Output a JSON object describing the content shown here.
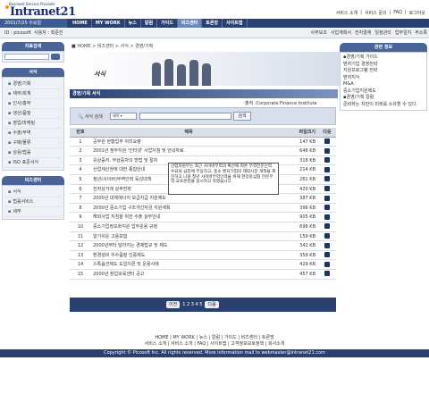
{
  "header": {
    "tagline": "Business Service Provider",
    "logo": "Intranet21",
    "top_links": [
      "서비스 소개",
      "서비스 문의",
      "FAQ",
      "로그아웃"
    ],
    "date": "2001/7/25 수요일",
    "nav": [
      "HOME",
      "MY WORK",
      "뉴스",
      "칼럼",
      "가이드",
      "비즈센터",
      "토론방",
      "사이트맵"
    ],
    "active_nav": "비즈센터"
  },
  "userbar": {
    "user": "ID : picosoft",
    "owner_label": "사용자 :",
    "owner": "최준진",
    "sub_menu": [
      "사무보조",
      "사업계획서",
      "전자결재",
      "일정관리",
      "업무일지",
      "주소록"
    ]
  },
  "left_sidebar": {
    "search_title": "자료검색",
    "forms_title": "서식",
    "forms": [
      "경영/기획",
      "재무/회계",
      "인사/총무",
      "생산/품질",
      "영업/마케팅",
      "수출/무역",
      "구매/물류",
      "상용/법률",
      "ISO 표준서식"
    ],
    "biz_title": "비즈센터",
    "biz": [
      "서식",
      "법률서비스",
      "세무"
    ]
  },
  "breadcrumb": "HOME > 비즈센터 > 서식 > 경영/기획",
  "banner_title": "서식",
  "section": {
    "title": "경영/기획 서식",
    "source": "출처 :Corporate Finance Institute"
  },
  "search": {
    "label": "서식 검색",
    "select": "제목",
    "button": "검색"
  },
  "table": {
    "headers": [
      "번호",
      "제목",
      "파일크기",
      "다운"
    ],
    "rows": [
      {
        "no": "1",
        "title": "공무원 현황업무 처리요령",
        "size": "147 KB"
      },
      {
        "no": "2",
        "title": "2001년 정부지원 '인터넷' 사업지침 및 안내자료",
        "size": "648 KB"
      },
      {
        "no": "3",
        "title": "유상증자, 무상증자의 방법 및 절차",
        "size": "318 KB"
      },
      {
        "no": "4",
        "title": "산업재산권에 대한 종합안내",
        "size": "214 KB"
      },
      {
        "no": "5",
        "title": "청년(사이버)무역인력 육성대책",
        "size": "261 KB"
      },
      {
        "no": "6",
        "title": "전자상거래 실무전략",
        "size": "420 KB"
      },
      {
        "no": "7",
        "title": "2000년 대체에너지 보급지급 지원제도",
        "size": "387 KB"
      },
      {
        "no": "8",
        "title": "2000년 중소기업 구조개선자금 지원계획",
        "size": "396 KB"
      },
      {
        "no": "9",
        "title": "해외사업 지침을 위한 수출 실무안내",
        "size": "905 KB"
      },
      {
        "no": "10",
        "title": "중소기업정보화지원 업무운용 규정",
        "size": "698 KB"
      },
      {
        "no": "11",
        "title": "알기쉬운 고용보험",
        "size": "159 KB"
      },
      {
        "no": "12",
        "title": "2000년부터 달라지는 경제법규 및 제도",
        "size": "342 KB"
      },
      {
        "no": "13",
        "title": "환경설비 우수품질 인증제도",
        "size": "359 KB"
      },
      {
        "no": "14",
        "title": "스톡옵션제도 도입이론 및 운용사례",
        "size": "429 KB"
      },
      {
        "no": "15",
        "title": "2000년 창업보육센터 공고",
        "size": "457 KB"
      }
    ]
  },
  "tooltip": "산업자원부는 최근 사이버무역의 확산에 따른 무역전문인력 수요의 급증에 부응하고, 중소 벤처기업의 해외시장 개척을 촉진하고 나갈 청년 사이버무역인력을 위해 현장중심형 전문무역 교육훈련을 실시하고 하였습니다.",
  "pager": {
    "prev": "이전",
    "pages": "1 2 3 4 5",
    "next": "다음"
  },
  "right_sidebar": {
    "title": "관련 정보",
    "items": [
      "경영/기획 가이드",
      "벤처기업 경영전략",
      "지원프로그램 전략",
      "벤처지식",
      "M&A",
      "중소기업지원제도",
      "경영/기획 칼럼",
      "준비하는 자만이 미래를 소유할 수 있다."
    ]
  },
  "footer": {
    "links1": "HOME | MY WORK | 뉴스 | 칼럼 | 가이드 | 비즈센터 | 토론방",
    "links2": "서비스 소개 | 서비스 소개 | FAQ | 사이트맵 | 고객정보보호정책 | 회사소개",
    "copyright": "Copyright © Picosoft Inc. All rights reserved. More information mail to webmaster@intranet21.com"
  },
  "colors": {
    "nav": "#2a4070",
    "accent": "#4a6498",
    "active": "#6c88bb"
  }
}
